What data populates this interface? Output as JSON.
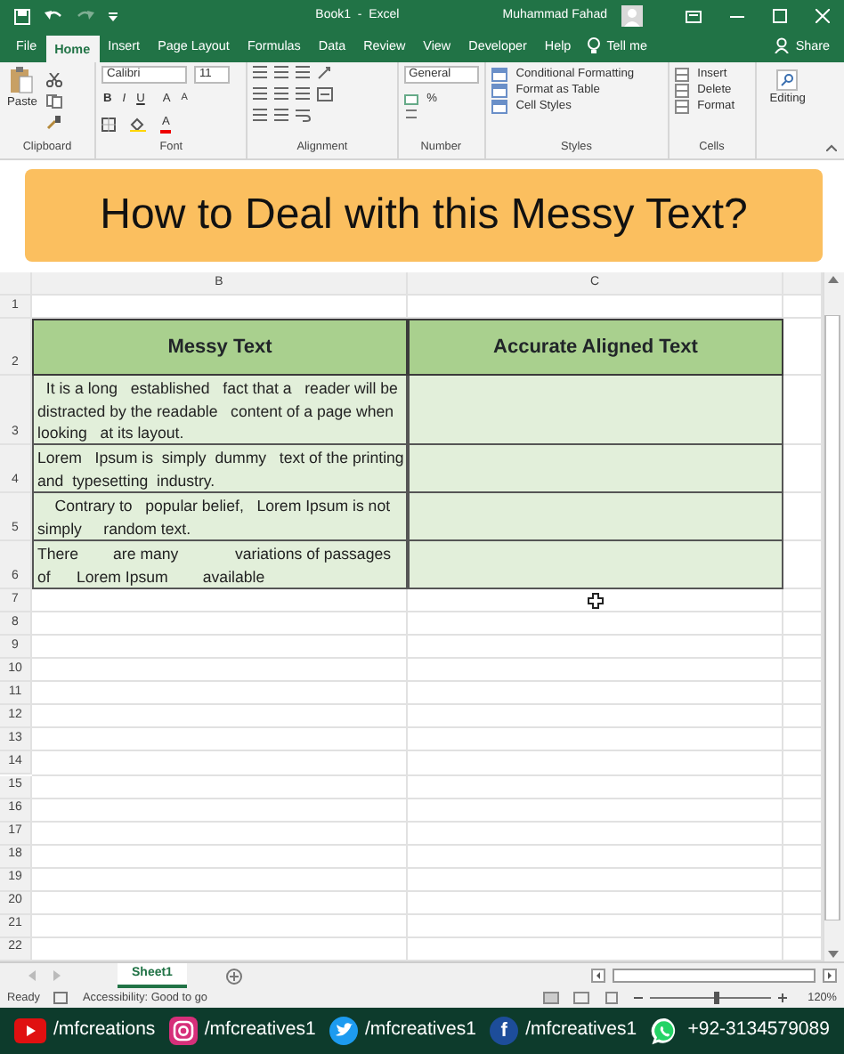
{
  "title_bar": {
    "document_title": "Book1  -  Excel",
    "user": "Muhammad Fahad"
  },
  "ribbon_tabs": [
    {
      "label": "File",
      "selected": false
    },
    {
      "label": "Home",
      "selected": true
    },
    {
      "label": "Insert",
      "selected": false
    },
    {
      "label": "Page Layout",
      "selected": false
    },
    {
      "label": "Formulas",
      "selected": false
    },
    {
      "label": "Data",
      "selected": false
    },
    {
      "label": "Review",
      "selected": false
    },
    {
      "label": "View",
      "selected": false
    },
    {
      "label": "Developer",
      "selected": false
    },
    {
      "label": "Help",
      "selected": false
    }
  ],
  "tell_me": "Tell me",
  "share": "Share",
  "ribbon": {
    "clipboard": {
      "paste": "Paste",
      "label": "Clipboard"
    },
    "font": {
      "font_name": "Calibri",
      "font_size": "11",
      "bold": "B",
      "italic": "I",
      "underline": "U",
      "grow": "A",
      "shrink": "A",
      "font_color": "A",
      "label": "Font"
    },
    "alignment": {
      "label": "Alignment"
    },
    "number": {
      "format": "General",
      "percent": "%",
      "label": "Number"
    },
    "styles": {
      "items": [
        "Conditional Formatting",
        "Format as Table",
        "Cell Styles"
      ],
      "label": "Styles"
    },
    "cells": {
      "items": [
        "Insert",
        "Delete",
        "Format"
      ],
      "label": "Cells"
    },
    "editing": {
      "label": "Editing"
    }
  },
  "banner": {
    "title": "How to Deal with this Messy Text?"
  },
  "sheet": {
    "columns": [
      "B",
      "C"
    ],
    "row_numbers": [
      "1",
      "2",
      "3",
      "4",
      "5",
      "6",
      "7",
      "8",
      "9",
      "10",
      "11",
      "12",
      "13",
      "14",
      "15",
      "16",
      "17",
      "18",
      "19",
      "20",
      "21",
      "22"
    ],
    "header": [
      "Messy Text",
      "Accurate Aligned Text"
    ],
    "messy_texts": [
      "  It is a long   established   fact that a   reader will be   distracted by the readable   content of a page when   looking   at its layout.",
      "Lorem   Ipsum is  simply  dummy   text of the printing and  typesetting  industry.",
      "    Contrary to   popular belief,   Lorem Ipsum is not simply     random text.",
      "There        are many             variations of passages of      Lorem Ipsum        available"
    ]
  },
  "sheet_tabs": [
    {
      "label": "Sheet1",
      "selected": true
    }
  ],
  "status_bar": {
    "status": "Ready",
    "accessibility": "Accessibility: Good to go",
    "zoom": "120%",
    "zoom_slider": {
      "level": 0.55
    }
  },
  "social": [
    {
      "kind": "youtube",
      "handle": "/mfcreations"
    },
    {
      "kind": "instagram",
      "handle": "/mfcreatives1"
    },
    {
      "kind": "twitter",
      "handle": "/mfcreatives1"
    },
    {
      "kind": "facebook",
      "glyph": "f",
      "handle": "/mfcreatives1"
    },
    {
      "kind": "whatsapp",
      "handle": "+92-3134579089"
    }
  ]
}
